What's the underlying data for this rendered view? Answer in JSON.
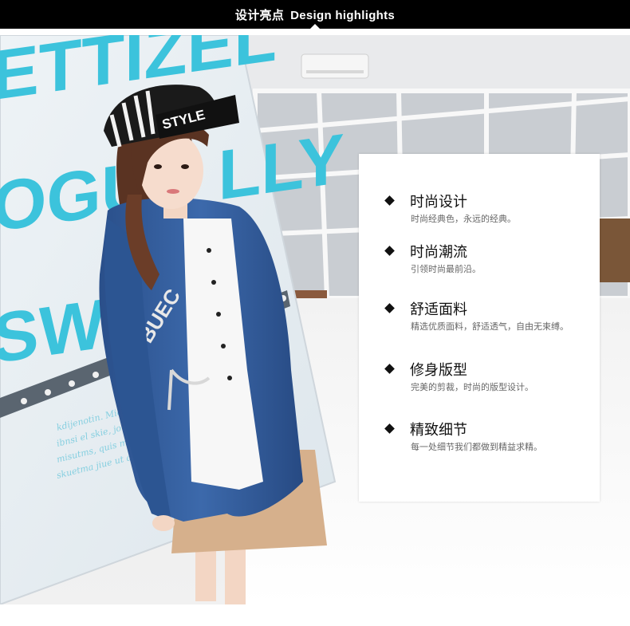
{
  "banner": {
    "title_cn": "设计亮点",
    "title_en": "Design highlights",
    "background": "#000000",
    "text_color": "#ffffff"
  },
  "photo": {
    "description_alt": "Model in striped STYLE cap and denim hooded coat leaning on a printed wall",
    "cap_text": "STYLE",
    "wall_text_1": "ETTIZEL",
    "wall_text_2": "OGUS LLY",
    "wall_text_3": "SWE X",
    "jacket_patch_text": "BUEC",
    "wall_small_text": [
      "kdijenotin. Miemsl s",
      "ibnsi el skie, jouwa.",
      "misutms, quis mostru",
      "skuetma jiue ut al qu"
    ],
    "accent_cyan": "#3cc3dc",
    "denim": "#2f5b9c"
  },
  "features": [
    {
      "title": "时尚设计",
      "desc": "时尚经典色，永远的经典。"
    },
    {
      "title": "时尚潮流",
      "desc": "引领时尚最前沿。"
    },
    {
      "title": "舒适面料",
      "desc": "精选优质面料，舒适透气，自由无束缚。"
    },
    {
      "title": "修身版型",
      "desc": "完美的剪裁，时尚的版型设计。"
    },
    {
      "title": "精致细节",
      "desc": "每一处细节我们都做到精益求精。"
    }
  ]
}
